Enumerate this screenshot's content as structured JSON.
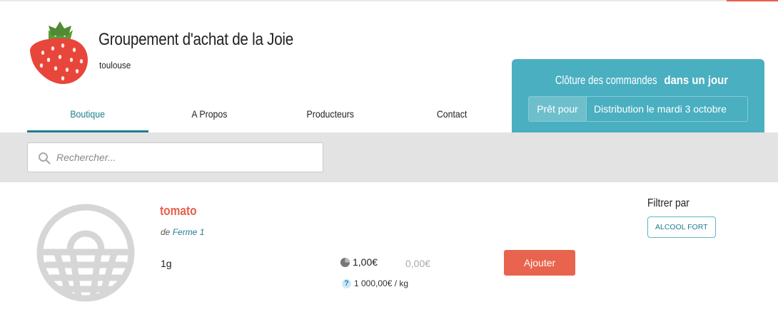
{
  "header": {
    "site_title": "Groupement d'achat de la Joie",
    "city": "toulouse",
    "nav": [
      {
        "label": "Boutique",
        "active": true
      },
      {
        "label": "A Propos",
        "active": false
      },
      {
        "label": "Producteurs",
        "active": false
      },
      {
        "label": "Contact",
        "active": false
      }
    ]
  },
  "order_box": {
    "title_prefix": "Clôture des commandes ",
    "title_emphasis": "dans un jour",
    "ready_label": "Prêt pour",
    "ready_value": "Distribution le mardi 3 octobre"
  },
  "search": {
    "placeholder": "Rechercher...",
    "value": ""
  },
  "product": {
    "name": "tomato",
    "by_prefix": "de ",
    "producer": "Ferme 1",
    "quantity": "1g",
    "price": "1,00€",
    "price_secondary": "0,00€",
    "unit_price_icon": "?",
    "unit_price": "1 000,00€ / kg",
    "add_label": "Ajouter",
    "image_icon": "basket-icon"
  },
  "filters": {
    "title": "Filtrer par",
    "tags": [
      "ALCOOL FORT"
    ]
  },
  "colors": {
    "accent": "#1e7e8f",
    "order_box": "#4aafc0",
    "cta": "#e8644e",
    "product_name": "#e8604c"
  }
}
